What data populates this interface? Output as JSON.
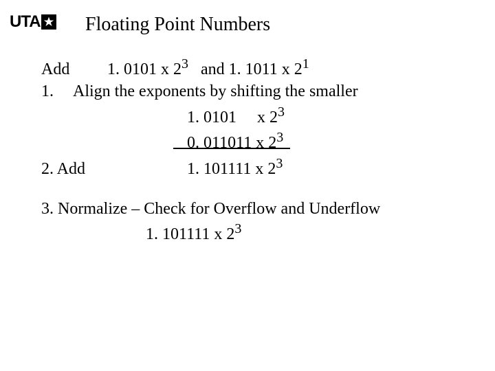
{
  "logo": {
    "text": "UTA"
  },
  "title": "Floating Point Numbers",
  "problem": {
    "label": "Add",
    "operand1_mantissa": "1. 0101 x 2",
    "operand1_exp": "3",
    "and_word": "and",
    "operand2_mantissa": "1. 1011 x 2",
    "operand2_exp": "1"
  },
  "step1": {
    "label_num": "1.",
    "label_text": "Align the exponents by shifting the smaller",
    "line_a_val": "1. 0101     x 2",
    "line_a_exp": "3",
    "line_b_val": "0. 011011 x 2",
    "line_b_exp": "3"
  },
  "step2": {
    "label": "2. Add",
    "val": "1. 101111 x 2",
    "exp": "3"
  },
  "step3": {
    "label": "3. Normalize – Check for Overflow and Underflow",
    "val": "1. 101111 x 2",
    "exp": "3"
  }
}
